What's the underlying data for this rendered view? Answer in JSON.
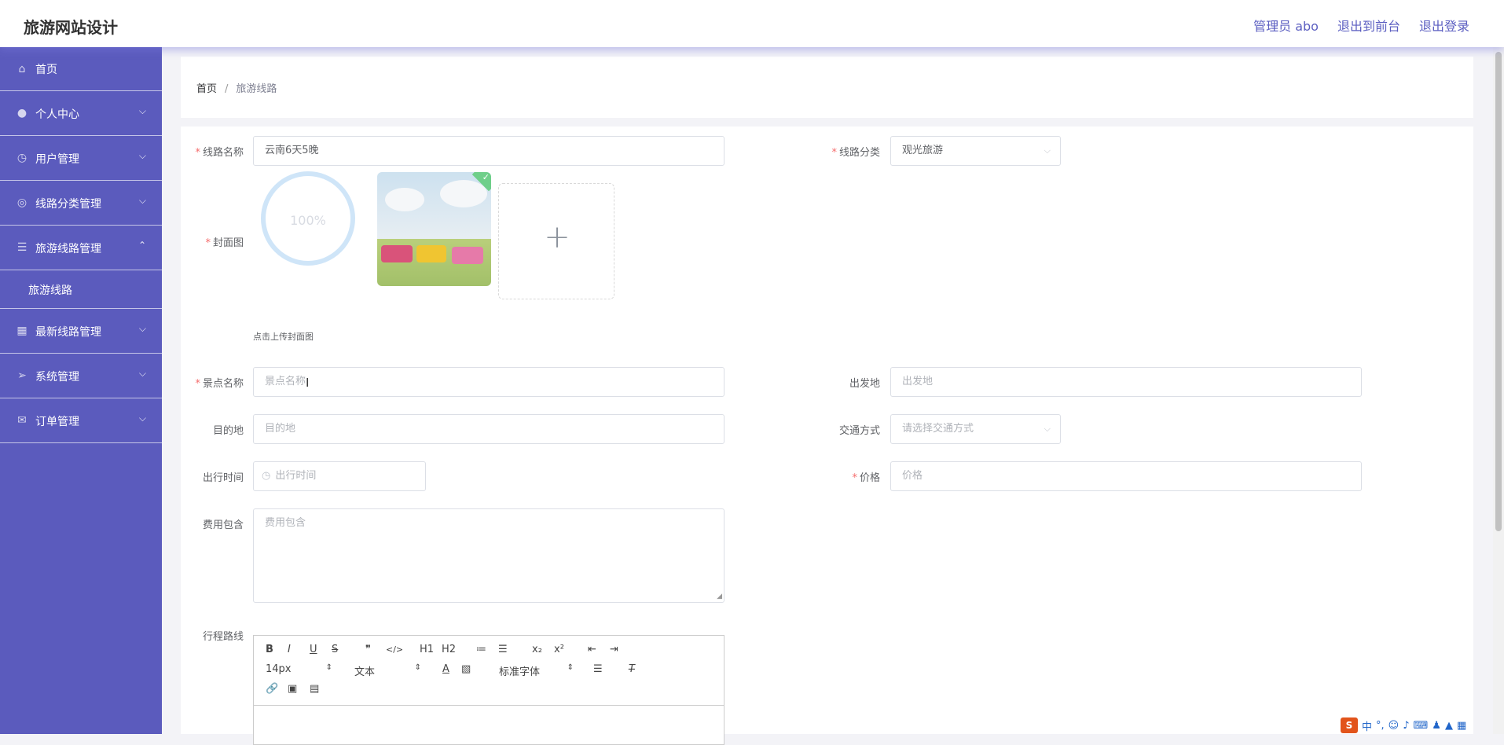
{
  "header": {
    "title": "旅游网站设计",
    "links": [
      "管理员 abo",
      "退出到前台",
      "退出登录"
    ]
  },
  "sidebar": {
    "items": [
      {
        "label": "首页",
        "icon": "home-icon",
        "chevron": ""
      },
      {
        "label": "个人中心",
        "icon": "user-icon",
        "chevron": "⌵"
      },
      {
        "label": "用户管理",
        "icon": "clock-icon",
        "chevron": "⌵"
      },
      {
        "label": "线路分类管理",
        "icon": "compass-icon",
        "chevron": "⌵"
      },
      {
        "label": "旅游线路管理",
        "icon": "sliders-icon",
        "chevron": "⌃"
      },
      {
        "label": "旅游线路",
        "icon": "",
        "chevron": ""
      },
      {
        "label": "最新线路管理",
        "icon": "chart-icon",
        "chevron": "⌵"
      },
      {
        "label": "系统管理",
        "icon": "send-icon",
        "chevron": "⌵"
      },
      {
        "label": "订单管理",
        "icon": "mail-icon",
        "chevron": "⌵"
      }
    ]
  },
  "breadcrumb": {
    "home": "首页",
    "separator": "/",
    "current": "旅游线路"
  },
  "form": {
    "route_name": {
      "label": "线路名称",
      "required": "*",
      "value": "云南6天5晚"
    },
    "route_category": {
      "label": "线路分类",
      "required": "*",
      "value": "观光旅游"
    },
    "cover": {
      "label": "封面图",
      "required": "*",
      "progress_text": "100%",
      "progress": 1.0,
      "tip": "点击上传封面图",
      "plus": "+"
    },
    "spot_name": {
      "label": "景点名称",
      "required": "*",
      "placeholder": "景点名称"
    },
    "departure": {
      "label": "出发地",
      "placeholder": "出发地"
    },
    "destination": {
      "label": "目的地",
      "placeholder": "目的地"
    },
    "transport": {
      "label": "交通方式",
      "placeholder": "请选择交通方式"
    },
    "depart_time": {
      "label": "出行时间",
      "placeholder": "出行时间"
    },
    "price": {
      "label": "价格",
      "required": "*",
      "placeholder": "价格"
    },
    "fee_includes": {
      "label": "费用包含",
      "placeholder": "费用包含"
    },
    "itinerary": {
      "label": "行程路线"
    }
  },
  "editor": {
    "font_size": "14px",
    "paragraph": "文本",
    "font_family": "标准字体",
    "buttons": [
      "B",
      "I",
      "U",
      "S",
      "❞",
      "</>",
      "H1",
      "H2",
      "≔",
      "☰",
      "x₂",
      "x²",
      "⇤",
      "⇥"
    ]
  },
  "tray": {
    "logo": "S",
    "lang": "中"
  }
}
